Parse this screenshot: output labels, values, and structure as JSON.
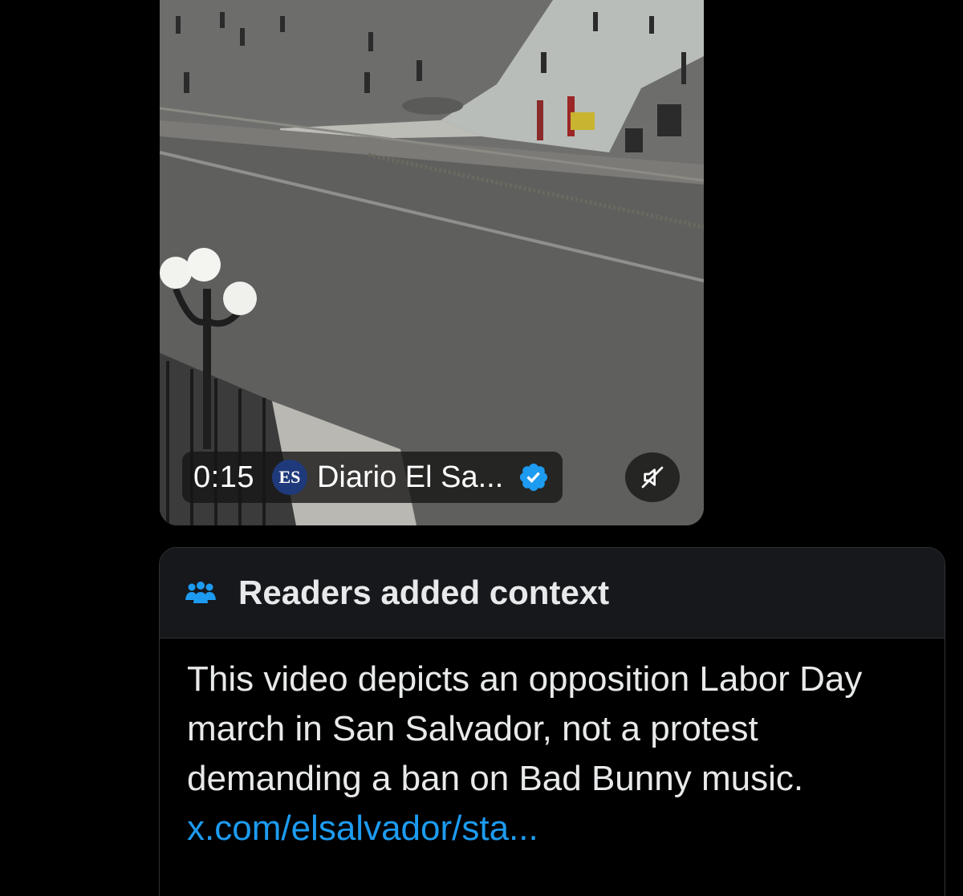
{
  "video": {
    "time": "0:15",
    "channel_logo_text": "ES",
    "channel_name": "Diario El Sa...",
    "verified_icon": "verified-badge-icon",
    "mute_icon": "muted-speaker-icon"
  },
  "note": {
    "title": "Readers added context",
    "header_icon": "people-group-icon",
    "body_text": "This video depicts an opposition Labor Day march in San Salvador, not a protest demanding a ban on Bad Bunny music. ",
    "link_text": "x.com/elsalvador/sta..."
  },
  "colors": {
    "background": "#000000",
    "note_header_bg": "#16181c",
    "border": "#2f3336",
    "text": "#e7e9ea",
    "link": "#1d9bf0",
    "verified": "#1d9bf0"
  }
}
